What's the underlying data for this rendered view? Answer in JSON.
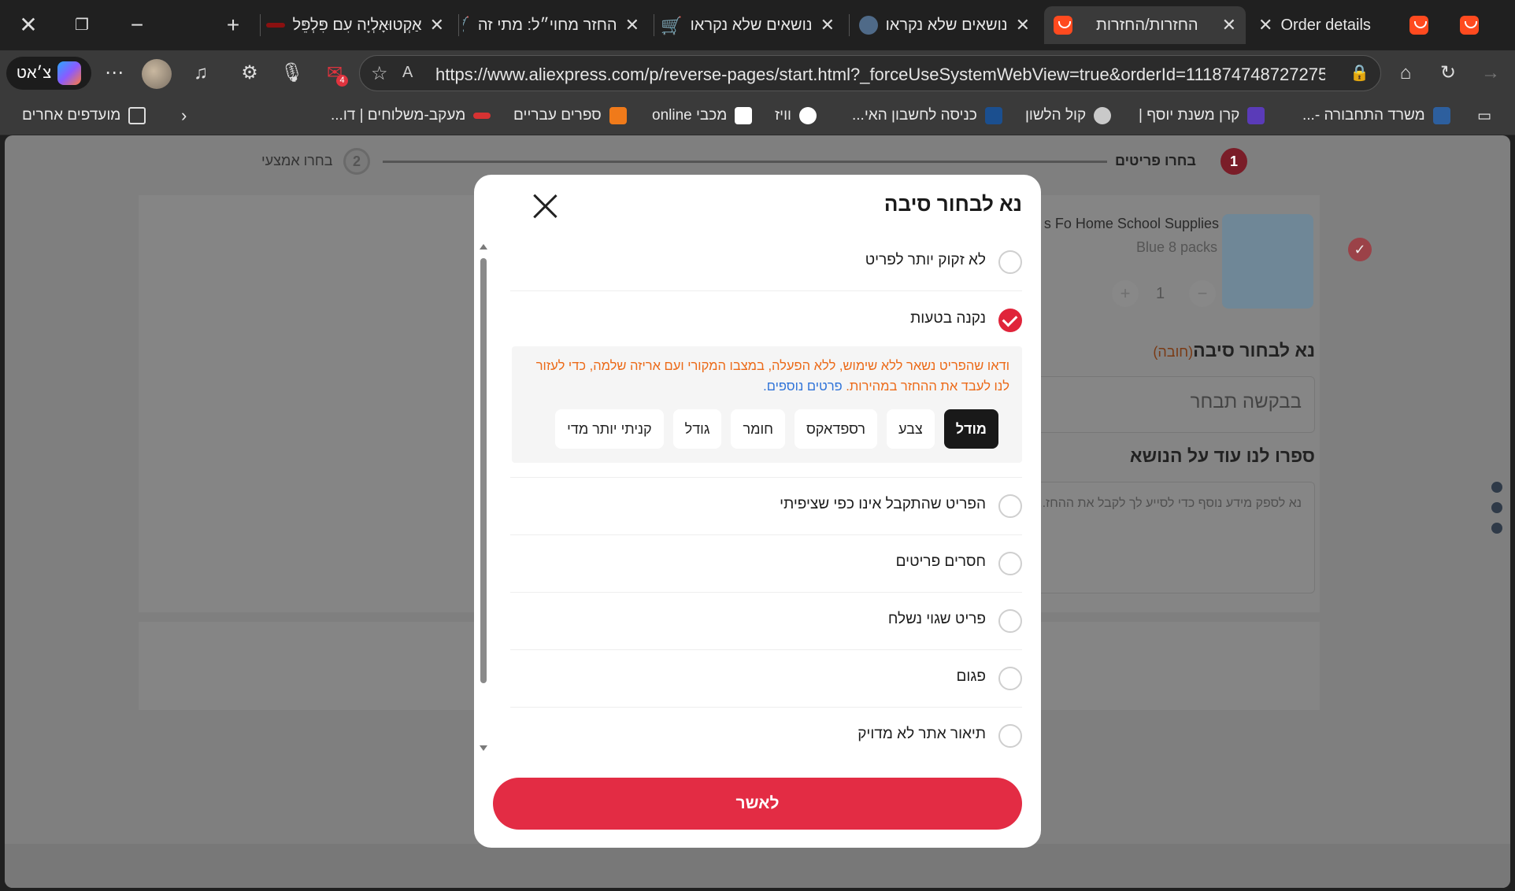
{
  "browser": {
    "tabs": [
      {
        "title": "Order details",
        "active": false
      },
      {
        "title": "החזרות/החזרות",
        "active": true
      },
      {
        "title": "נושאים שלא נקראו",
        "active": false
      },
      {
        "title": "נושאים שלא נקראו",
        "active": false
      },
      {
        "title": "החזר מחוי״ל: מתי זה",
        "active": false
      },
      {
        "title": "אַקְטוּאָלְיָה עִם פִּלְפֵּל",
        "active": false
      }
    ],
    "address": {
      "url": "https://www.aliexpress.com/p/reverse-pages/start.html?_forceUseSystemWebView=true&orderId=1118747487272753&rec..."
    },
    "chat_label": "צ׳אט",
    "mail_badge": "4",
    "bookmarks": [
      "משרד התחבורה -...",
      "קרן משנת יוסף |",
      "קול הלשון",
      "כניסה לחשבון האי...",
      "וויז",
      "מכבי online",
      "ספרים עבריים",
      "מעקב-משלוחים | דו...",
      "מועדפים אחרים"
    ]
  },
  "page": {
    "steps": [
      {
        "num": "1",
        "label": "בחרו פריטים"
      },
      {
        "num": "2",
        "label": "בחרו אמצעי"
      }
    ],
    "product": {
      "title": "s Fo Home School Supplies",
      "variant": "Blue 8 packs",
      "qty": "1",
      "minus": "−",
      "plus": "+"
    },
    "reason_heading": "נא לבחור סיבה",
    "reason_required": "(חובה)",
    "reason_placeholder": "בבקשה תבחר",
    "tell_heading": "ספרו לנו עוד על הנושא",
    "tell_placeholder": "נא לספק מידע נוסף כדי לסייע לך לקבל את ההחז..."
  },
  "modal": {
    "title": "נא לבחור סיבה",
    "reasons": [
      {
        "label": "לא זקוק יותר לפריט",
        "checked": false
      },
      {
        "label": "נקנה בטעות",
        "checked": true
      },
      {
        "label": "הפריט שהתקבל אינו כפי שציפיתי",
        "checked": false
      },
      {
        "label": "חסרים פריטים",
        "checked": false
      },
      {
        "label": "פריט שגוי נשלח",
        "checked": false
      },
      {
        "label": "פגום",
        "checked": false
      },
      {
        "label": "תיאור אתר לא מדויק",
        "checked": false
      }
    ],
    "info": {
      "text": "ודאו שהפריט נשאר ללא שימוש, ללא הפעלה, במצבו המקורי ועם אריזה שלמה, כדי לעזור לנו לעבד את ההחזר במהירות.",
      "link": "פרטים נוספים."
    },
    "chips": [
      {
        "label": "מודל",
        "selected": true
      },
      {
        "label": "צבע",
        "selected": false
      },
      {
        "label": "רספדאקס",
        "selected": false
      },
      {
        "label": "חומר",
        "selected": false
      },
      {
        "label": "גודל",
        "selected": false
      },
      {
        "label": "קניתי יותר מדי",
        "selected": false
      }
    ],
    "confirm_label": "לאשר"
  },
  "colors": {
    "accent": "#e32c44",
    "info_text": "#ec6a18",
    "link": "#2f73d8"
  }
}
